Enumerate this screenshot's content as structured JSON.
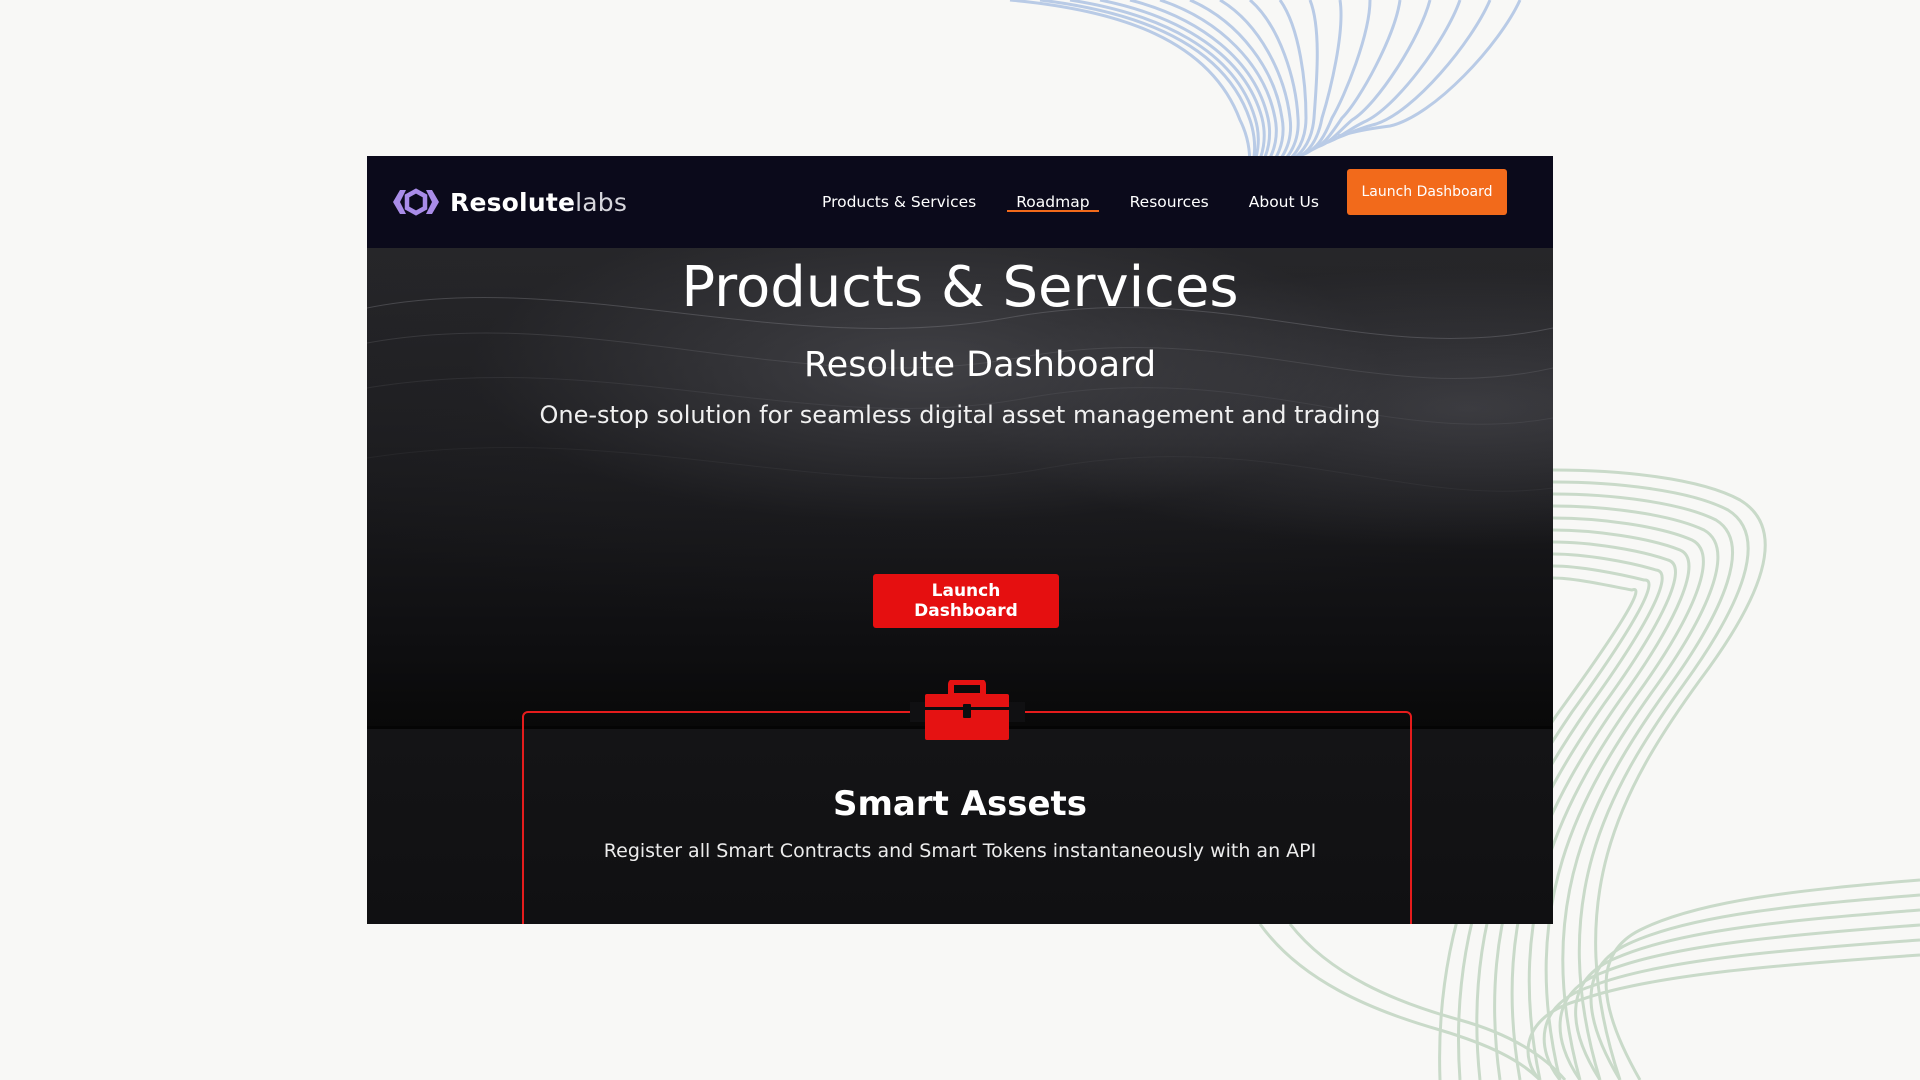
{
  "brand": {
    "name_bold": "Resolute",
    "name_light": "labs",
    "accent": "#a98ce8"
  },
  "nav": {
    "items": [
      {
        "label": "Products & Services",
        "active": false
      },
      {
        "label": "Roadmap",
        "active": true
      },
      {
        "label": "Resources",
        "active": false
      },
      {
        "label": "About Us",
        "active": false
      }
    ],
    "cta_label": "Launch Dashboard",
    "cta_color": "#f26a1b"
  },
  "hero": {
    "title": "Products & Services",
    "product_title": "Resolute Dashboard",
    "product_subtitle": "One-stop solution for seamless digital asset management and trading",
    "cta_label": "Launch Dashboard",
    "cta_color": "#e50f10"
  },
  "feature_card": {
    "icon": "toolbox-icon",
    "title": "Smart Assets",
    "description": "Register all Smart Contracts and Smart Tokens instantaneously with an API",
    "border_color": "#e51c1c"
  }
}
